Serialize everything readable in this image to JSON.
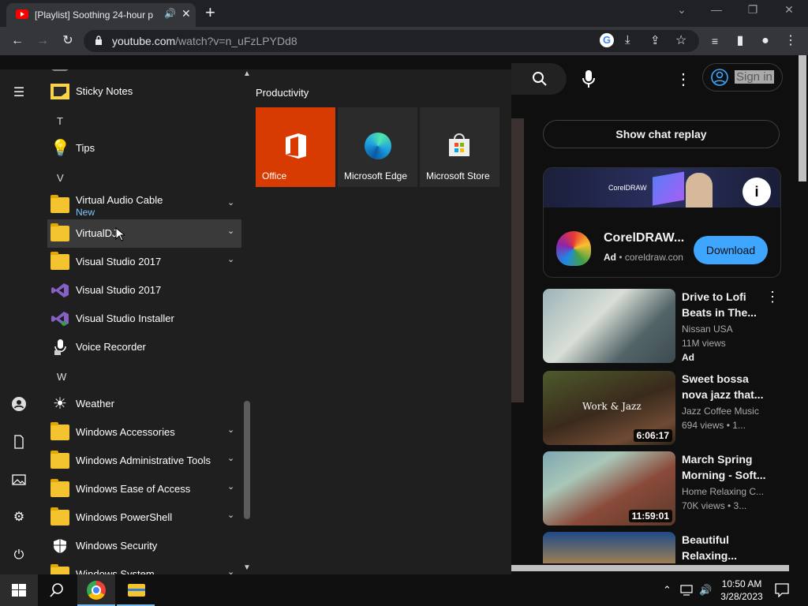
{
  "browser": {
    "tab_title": "[Playlist] Soothing 24-hour p",
    "url_domain": "youtube.com",
    "url_path": "/watch?v=n_uFzLPYDd8"
  },
  "youtube": {
    "sign_in": "Sign in",
    "chat_replay": "Show chat replay",
    "ad": {
      "brand": "CorelDRAW",
      "title": "CorelDRAW...",
      "ad_label": "Ad",
      "domain": "coreldraw.con",
      "download": "Download",
      "info": "i"
    },
    "videos": [
      {
        "title": "Drive to Lofi Beats in The...",
        "channel": "Nissan USA",
        "views": "11M views",
        "badge": "Ad",
        "duration": ""
      },
      {
        "title": "Sweet bossa nova jazz that...",
        "channel": "Jazz Coffee Music",
        "views": "694 views • 1...",
        "badge": "",
        "duration": "6:06:17",
        "thumb_text": "Work & Jazz"
      },
      {
        "title": "March Spring Morning - Soft...",
        "channel": "Home Relaxing C...",
        "views": "70K views • 3...",
        "badge": "",
        "duration": "11:59:01"
      },
      {
        "title": "Beautiful Relaxing...",
        "channel": "",
        "views": "",
        "badge": "",
        "duration": ""
      }
    ]
  },
  "start_menu": {
    "apps": [
      {
        "kind": "app",
        "name": "Sticky Notes",
        "icon": "sticky-notes-icon"
      },
      {
        "kind": "letter",
        "name": "T"
      },
      {
        "kind": "app",
        "name": "Tips",
        "icon": "lightbulb-icon"
      },
      {
        "kind": "letter",
        "name": "V"
      },
      {
        "kind": "folder",
        "name": "Virtual Audio Cable",
        "sub": "New"
      },
      {
        "kind": "folder",
        "name": "VirtualDJ"
      },
      {
        "kind": "folder",
        "name": "Visual Studio 2017"
      },
      {
        "kind": "app",
        "name": "Visual Studio 2017",
        "icon": "visual-studio-icon"
      },
      {
        "kind": "app",
        "name": "Visual Studio Installer",
        "icon": "visual-studio-installer-icon"
      },
      {
        "kind": "app",
        "name": "Voice Recorder",
        "icon": "microphone-icon"
      },
      {
        "kind": "letter",
        "name": "W"
      },
      {
        "kind": "app",
        "name": "Weather",
        "icon": "sun-icon"
      },
      {
        "kind": "folder",
        "name": "Windows Accessories"
      },
      {
        "kind": "folder",
        "name": "Windows Administrative Tools"
      },
      {
        "kind": "folder",
        "name": "Windows Ease of Access"
      },
      {
        "kind": "folder",
        "name": "Windows PowerShell"
      },
      {
        "kind": "app",
        "name": "Windows Security",
        "icon": "shield-icon"
      },
      {
        "kind": "folder",
        "name": "Windows System"
      }
    ],
    "tiles_group": "Productivity",
    "tiles": [
      "Office",
      "Microsoft Edge",
      "Microsoft Store"
    ]
  },
  "taskbar": {
    "time": "10:50 AM",
    "date": "3/28/2023"
  }
}
